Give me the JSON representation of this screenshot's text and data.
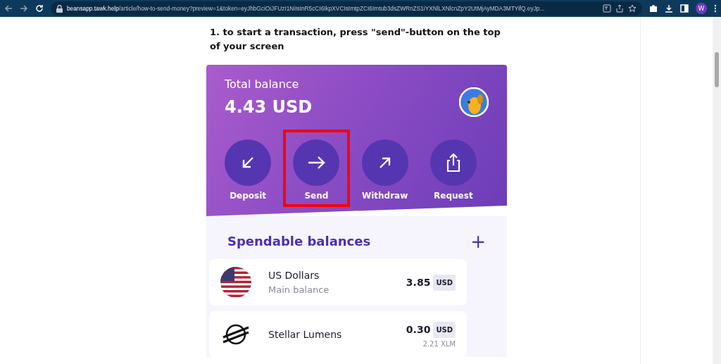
{
  "browser": {
    "url_host": "beansapp.tawk.help",
    "url_path": "/article/how-to-send-money?preview=1&token=eyJhbGciOiJFUzI1NiIsInR5cCI6IkpXVCIsImtpZCI6Imtub3dsZWRnZS1iYXNlLXNlcnZpY2UtMjAyMDA3MTYifQ.eyJp...",
    "profile": "W"
  },
  "article": {
    "step": "1. to start a transaction, press \"send\"-button on the top of your screen"
  },
  "app": {
    "total_label": "Total balance",
    "total_amount": "4.43 USD",
    "actions": [
      {
        "label": "Deposit",
        "kind": "deposit",
        "highlighted": false
      },
      {
        "label": "Send",
        "kind": "send",
        "highlighted": true
      },
      {
        "label": "Withdraw",
        "kind": "withdraw",
        "highlighted": false
      },
      {
        "label": "Request",
        "kind": "request",
        "highlighted": false
      }
    ],
    "section_title": "Spendable balances",
    "add_symbol": "+",
    "balances": [
      {
        "kind": "usd",
        "name": "US Dollars",
        "subtitle": "Main balance",
        "amount": "3.85",
        "currency": "USD"
      },
      {
        "kind": "xlm",
        "name": "Stellar Lumens",
        "amount": "0.30",
        "currency": "USD",
        "secondary": "2.21 XLM"
      }
    ]
  }
}
